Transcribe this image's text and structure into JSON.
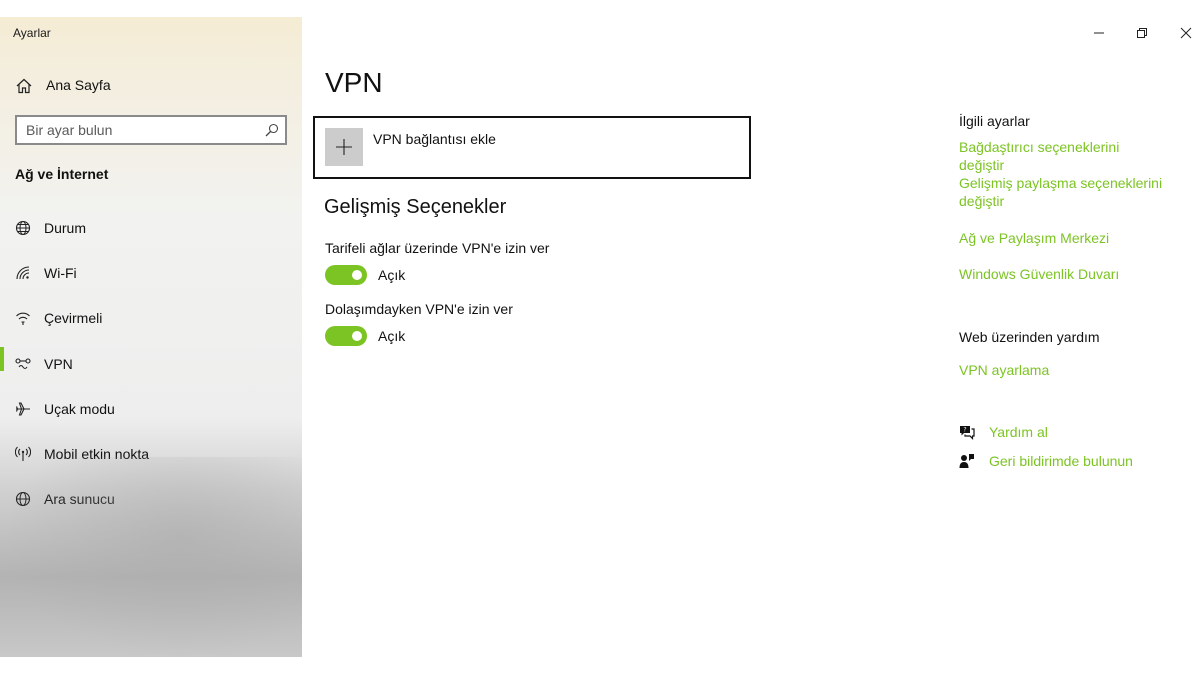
{
  "window": {
    "title": "Ayarlar",
    "minimize_icon": "minimize-icon",
    "maximize_icon": "restore-icon",
    "close_icon": "close-icon"
  },
  "sidebar": {
    "home_label": "Ana Sayfa",
    "home_icon": "home-icon",
    "search_placeholder": "Bir ayar bulun",
    "search_icon": "search-icon",
    "section_title": "Ağ ve İnternet",
    "items": [
      {
        "label": "Durum",
        "icon": "globe-status-icon",
        "active": false
      },
      {
        "label": "Wi-Fi",
        "icon": "wifi-icon",
        "active": false
      },
      {
        "label": "Çevirmeli",
        "icon": "dialup-icon",
        "active": false
      },
      {
        "label": "VPN",
        "icon": "vpn-icon",
        "active": true
      },
      {
        "label": "Uçak modu",
        "icon": "airplane-icon",
        "active": false
      },
      {
        "label": "Mobil etkin nokta",
        "icon": "hotspot-icon",
        "active": false
      },
      {
        "label": "Ara sunucu",
        "icon": "globe-icon",
        "active": false
      }
    ]
  },
  "main": {
    "title": "VPN",
    "add_vpn_label": "VPN bağlantısı ekle",
    "advanced_title": "Gelişmiş Seçenekler",
    "settings": [
      {
        "label": "Tarifeli ağlar üzerinde VPN'e izin ver",
        "state": "Açık",
        "on": true
      },
      {
        "label": "Dolaşımdayken VPN'e izin ver",
        "state": "Açık",
        "on": true
      }
    ]
  },
  "related": {
    "header": "İlgili ayarlar",
    "links": [
      "Bağdaştırıcı seçeneklerini değiştir",
      "Gelişmiş paylaşma seçeneklerini değiştir",
      "Ağ ve Paylaşım Merkezi",
      "Windows Güvenlik Duvarı"
    ]
  },
  "web_help": {
    "header": "Web üzerinden yardım",
    "link": "VPN ayarlama"
  },
  "help": {
    "get_help": "Yardım al",
    "feedback": "Geri bildirimde bulunun"
  },
  "colors": {
    "accent": "#7cc423",
    "text": "#111111",
    "add_button_bg": "#cccccc"
  }
}
